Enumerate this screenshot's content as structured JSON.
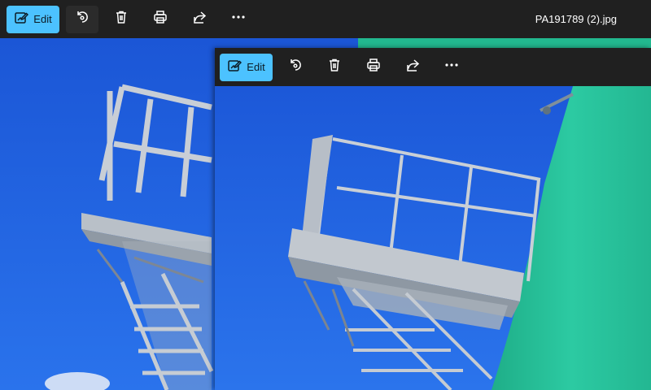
{
  "back_window": {
    "toolbar": {
      "edit_label": "Edit",
      "rotate_icon": "rotate-icon",
      "delete_icon": "trash-icon",
      "print_icon": "printer-icon",
      "share_icon": "share-icon",
      "more_icon": "more-icon"
    },
    "file_name": "PA191789 (2).jpg"
  },
  "front_window": {
    "toolbar": {
      "edit_label": "Edit",
      "rotate_icon": "rotate-icon",
      "delete_icon": "trash-icon",
      "print_icon": "printer-icon",
      "share_icon": "share-icon",
      "more_icon": "more-icon"
    }
  },
  "colors": {
    "accent": "#4cc2ff",
    "toolbar_bg": "#202020",
    "sky": "#1e5fd8",
    "tank": "#27c39c",
    "steel": "#c9cfd6"
  }
}
